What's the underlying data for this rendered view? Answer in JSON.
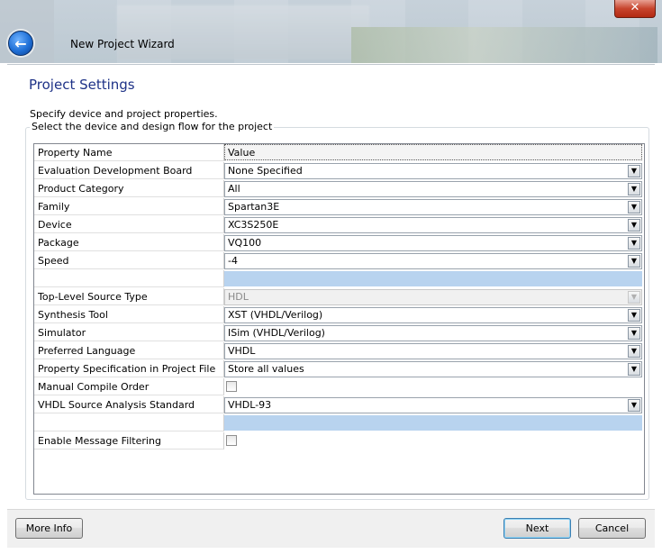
{
  "window": {
    "title": "New Project Wizard",
    "close_label": "✕"
  },
  "page": {
    "heading": "Project Settings",
    "description_1": "Specify device and project properties.",
    "group_label": "Select the device and design flow for the project"
  },
  "grid": {
    "header": {
      "name": "Property Name",
      "value": "Value"
    },
    "rows": [
      {
        "name": "Evaluation Development Board",
        "value": "None Specified",
        "kind": "combo"
      },
      {
        "name": "Product Category",
        "value": "All",
        "kind": "combo"
      },
      {
        "name": "Family",
        "value": "Spartan3E",
        "kind": "combo"
      },
      {
        "name": "Device",
        "value": "XC3S250E",
        "kind": "combo"
      },
      {
        "name": "Package",
        "value": "VQ100",
        "kind": "combo"
      },
      {
        "name": "Speed",
        "value": "-4",
        "kind": "combo"
      },
      {
        "name": "",
        "value": "",
        "kind": "separator"
      },
      {
        "name": "Top-Level Source Type",
        "value": "HDL",
        "kind": "combo-disabled"
      },
      {
        "name": "Synthesis Tool",
        "value": "XST (VHDL/Verilog)",
        "kind": "combo"
      },
      {
        "name": "Simulator",
        "value": "ISim (VHDL/Verilog)",
        "kind": "combo"
      },
      {
        "name": "Preferred Language",
        "value": "VHDL",
        "kind": "combo"
      },
      {
        "name": "Property Specification in Project File",
        "value": "Store all values",
        "kind": "combo"
      },
      {
        "name": "Manual Compile Order",
        "value": "",
        "kind": "checkbox"
      },
      {
        "name": "VHDL Source Analysis Standard",
        "value": "VHDL-93",
        "kind": "combo"
      },
      {
        "name": "",
        "value": "",
        "kind": "separator"
      },
      {
        "name": "Enable Message Filtering",
        "value": "",
        "kind": "checkbox"
      }
    ]
  },
  "buttons": {
    "more_info": "More Info",
    "next": "Next",
    "cancel": "Cancel"
  }
}
